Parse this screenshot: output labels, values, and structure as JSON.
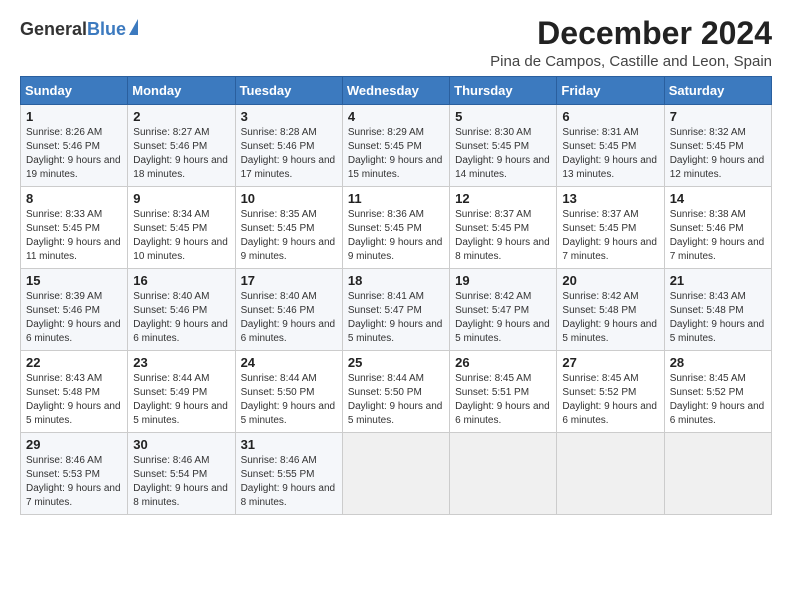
{
  "header": {
    "logo_general": "General",
    "logo_blue": "Blue",
    "month_title": "December 2024",
    "location": "Pina de Campos, Castille and Leon, Spain"
  },
  "weekdays": [
    "Sunday",
    "Monday",
    "Tuesday",
    "Wednesday",
    "Thursday",
    "Friday",
    "Saturday"
  ],
  "weeks": [
    [
      {
        "day": "1",
        "sunrise": "Sunrise: 8:26 AM",
        "sunset": "Sunset: 5:46 PM",
        "daylight": "Daylight: 9 hours and 19 minutes."
      },
      {
        "day": "2",
        "sunrise": "Sunrise: 8:27 AM",
        "sunset": "Sunset: 5:46 PM",
        "daylight": "Daylight: 9 hours and 18 minutes."
      },
      {
        "day": "3",
        "sunrise": "Sunrise: 8:28 AM",
        "sunset": "Sunset: 5:46 PM",
        "daylight": "Daylight: 9 hours and 17 minutes."
      },
      {
        "day": "4",
        "sunrise": "Sunrise: 8:29 AM",
        "sunset": "Sunset: 5:45 PM",
        "daylight": "Daylight: 9 hours and 15 minutes."
      },
      {
        "day": "5",
        "sunrise": "Sunrise: 8:30 AM",
        "sunset": "Sunset: 5:45 PM",
        "daylight": "Daylight: 9 hours and 14 minutes."
      },
      {
        "day": "6",
        "sunrise": "Sunrise: 8:31 AM",
        "sunset": "Sunset: 5:45 PM",
        "daylight": "Daylight: 9 hours and 13 minutes."
      },
      {
        "day": "7",
        "sunrise": "Sunrise: 8:32 AM",
        "sunset": "Sunset: 5:45 PM",
        "daylight": "Daylight: 9 hours and 12 minutes."
      }
    ],
    [
      {
        "day": "8",
        "sunrise": "Sunrise: 8:33 AM",
        "sunset": "Sunset: 5:45 PM",
        "daylight": "Daylight: 9 hours and 11 minutes."
      },
      {
        "day": "9",
        "sunrise": "Sunrise: 8:34 AM",
        "sunset": "Sunset: 5:45 PM",
        "daylight": "Daylight: 9 hours and 10 minutes."
      },
      {
        "day": "10",
        "sunrise": "Sunrise: 8:35 AM",
        "sunset": "Sunset: 5:45 PM",
        "daylight": "Daylight: 9 hours and 9 minutes."
      },
      {
        "day": "11",
        "sunrise": "Sunrise: 8:36 AM",
        "sunset": "Sunset: 5:45 PM",
        "daylight": "Daylight: 9 hours and 9 minutes."
      },
      {
        "day": "12",
        "sunrise": "Sunrise: 8:37 AM",
        "sunset": "Sunset: 5:45 PM",
        "daylight": "Daylight: 9 hours and 8 minutes."
      },
      {
        "day": "13",
        "sunrise": "Sunrise: 8:37 AM",
        "sunset": "Sunset: 5:45 PM",
        "daylight": "Daylight: 9 hours and 7 minutes."
      },
      {
        "day": "14",
        "sunrise": "Sunrise: 8:38 AM",
        "sunset": "Sunset: 5:46 PM",
        "daylight": "Daylight: 9 hours and 7 minutes."
      }
    ],
    [
      {
        "day": "15",
        "sunrise": "Sunrise: 8:39 AM",
        "sunset": "Sunset: 5:46 PM",
        "daylight": "Daylight: 9 hours and 6 minutes."
      },
      {
        "day": "16",
        "sunrise": "Sunrise: 8:40 AM",
        "sunset": "Sunset: 5:46 PM",
        "daylight": "Daylight: 9 hours and 6 minutes."
      },
      {
        "day": "17",
        "sunrise": "Sunrise: 8:40 AM",
        "sunset": "Sunset: 5:46 PM",
        "daylight": "Daylight: 9 hours and 6 minutes."
      },
      {
        "day": "18",
        "sunrise": "Sunrise: 8:41 AM",
        "sunset": "Sunset: 5:47 PM",
        "daylight": "Daylight: 9 hours and 5 minutes."
      },
      {
        "day": "19",
        "sunrise": "Sunrise: 8:42 AM",
        "sunset": "Sunset: 5:47 PM",
        "daylight": "Daylight: 9 hours and 5 minutes."
      },
      {
        "day": "20",
        "sunrise": "Sunrise: 8:42 AM",
        "sunset": "Sunset: 5:48 PM",
        "daylight": "Daylight: 9 hours and 5 minutes."
      },
      {
        "day": "21",
        "sunrise": "Sunrise: 8:43 AM",
        "sunset": "Sunset: 5:48 PM",
        "daylight": "Daylight: 9 hours and 5 minutes."
      }
    ],
    [
      {
        "day": "22",
        "sunrise": "Sunrise: 8:43 AM",
        "sunset": "Sunset: 5:48 PM",
        "daylight": "Daylight: 9 hours and 5 minutes."
      },
      {
        "day": "23",
        "sunrise": "Sunrise: 8:44 AM",
        "sunset": "Sunset: 5:49 PM",
        "daylight": "Daylight: 9 hours and 5 minutes."
      },
      {
        "day": "24",
        "sunrise": "Sunrise: 8:44 AM",
        "sunset": "Sunset: 5:50 PM",
        "daylight": "Daylight: 9 hours and 5 minutes."
      },
      {
        "day": "25",
        "sunrise": "Sunrise: 8:44 AM",
        "sunset": "Sunset: 5:50 PM",
        "daylight": "Daylight: 9 hours and 5 minutes."
      },
      {
        "day": "26",
        "sunrise": "Sunrise: 8:45 AM",
        "sunset": "Sunset: 5:51 PM",
        "daylight": "Daylight: 9 hours and 6 minutes."
      },
      {
        "day": "27",
        "sunrise": "Sunrise: 8:45 AM",
        "sunset": "Sunset: 5:52 PM",
        "daylight": "Daylight: 9 hours and 6 minutes."
      },
      {
        "day": "28",
        "sunrise": "Sunrise: 8:45 AM",
        "sunset": "Sunset: 5:52 PM",
        "daylight": "Daylight: 9 hours and 6 minutes."
      }
    ],
    [
      {
        "day": "29",
        "sunrise": "Sunrise: 8:46 AM",
        "sunset": "Sunset: 5:53 PM",
        "daylight": "Daylight: 9 hours and 7 minutes."
      },
      {
        "day": "30",
        "sunrise": "Sunrise: 8:46 AM",
        "sunset": "Sunset: 5:54 PM",
        "daylight": "Daylight: 9 hours and 8 minutes."
      },
      {
        "day": "31",
        "sunrise": "Sunrise: 8:46 AM",
        "sunset": "Sunset: 5:55 PM",
        "daylight": "Daylight: 9 hours and 8 minutes."
      },
      null,
      null,
      null,
      null
    ]
  ]
}
